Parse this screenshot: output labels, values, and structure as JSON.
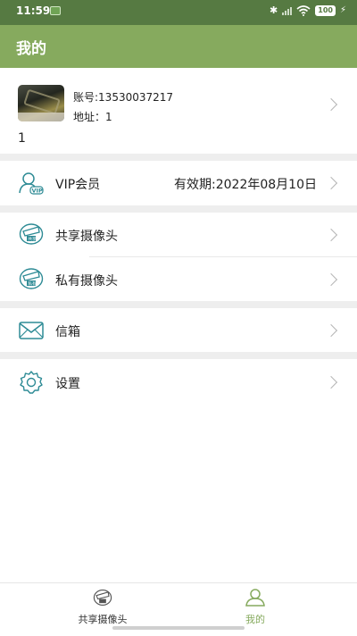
{
  "status_bar": {
    "time": "11:59",
    "battery": "100"
  },
  "header": {
    "title": "我的"
  },
  "profile": {
    "account": "账号:13530037217",
    "address": "地址：1",
    "name": "1"
  },
  "menu": {
    "vip": {
      "label": "VIP会员",
      "value": "有效期:2022年08月10日",
      "icon": "vip-user-icon"
    },
    "shared_camera": {
      "label": "共享摄像头",
      "icon": "shared-camera-icon"
    },
    "private_camera": {
      "label": "私有摄像头",
      "icon": "private-camera-icon"
    },
    "mailbox": {
      "label": "信箱",
      "icon": "envelope-icon"
    },
    "settings": {
      "label": "设置",
      "icon": "gear-icon"
    }
  },
  "bottom_nav": {
    "items": [
      {
        "label": "共享摄像头",
        "icon": "camera-icon",
        "active": false
      },
      {
        "label": "我的",
        "icon": "person-icon",
        "active": true
      }
    ]
  },
  "colors": {
    "accent": "#86aa5e",
    "status_bar": "#567a42",
    "icon_teal": "#2e8b95"
  }
}
